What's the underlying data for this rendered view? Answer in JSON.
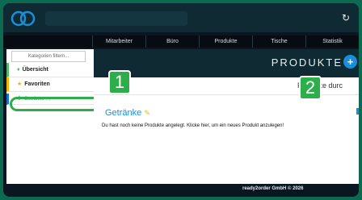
{
  "nav": {
    "items": [
      "Mitarbeiter",
      "Büro",
      "Produkte",
      "Tische",
      "Statistik"
    ]
  },
  "sidebar": {
    "filter_placeholder": "Kategorien filtern...",
    "overview": "Übersicht",
    "favorites": "Favoriten",
    "category": {
      "label": "Getränke",
      "count": "(0)"
    }
  },
  "main": {
    "title": "PRODUKTE",
    "search_text": "Produkte durc",
    "category_title": "Getränke",
    "empty_message": "Du hast noch keine Produkte angelegt.  Klicke hier, um ein neues Produkt anzulegen!"
  },
  "callouts": {
    "one": "1",
    "two": "2"
  },
  "footer": {
    "text": "ready2order GmbH © 2026"
  },
  "colors": {
    "accent": "#2eae4a",
    "blue": "#1a8fd8",
    "dark": "#0f2a33"
  }
}
